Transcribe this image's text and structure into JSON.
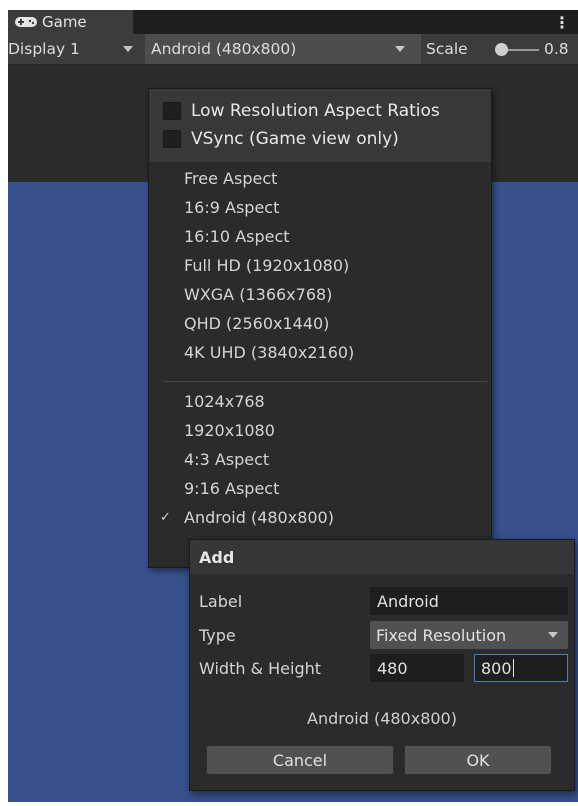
{
  "tab": {
    "label": "Game",
    "icon": "gamepad-icon",
    "more_icon": "kebab-menu-icon"
  },
  "toolbar": {
    "display": "Display 1",
    "aspect": "Android (480x800)",
    "scale_label": "Scale",
    "scale_value": "0.8"
  },
  "menu": {
    "options": [
      {
        "label": "Low Resolution Aspect Ratios",
        "checked": false
      },
      {
        "label": "VSync (Game view only)",
        "checked": false
      }
    ],
    "builtin": [
      "Free Aspect",
      "16:9 Aspect",
      "16:10 Aspect",
      "Full HD (1920x1080)",
      "WXGA (1366x768)",
      "QHD (2560x1440)",
      "4K UHD (3840x2160)"
    ],
    "custom": [
      "1024x768",
      "1920x1080",
      "4:3 Aspect",
      "9:16 Aspect",
      "Android (480x800)"
    ],
    "selected": "Android (480x800)",
    "check_mark": "✓"
  },
  "dialog": {
    "title": "Add",
    "label_label": "Label",
    "label_value": "Android",
    "type_label": "Type",
    "type_value": "Fixed Resolution",
    "size_label": "Width & Height",
    "width": "480",
    "height": "800",
    "preview": "Android (480x800)",
    "cancel": "Cancel",
    "ok": "OK"
  },
  "colors": {
    "viewport": "#37518c",
    "panel": "#2b2b2b",
    "toolbar": "#3c3c3c",
    "focus": "#4b7fb8"
  }
}
